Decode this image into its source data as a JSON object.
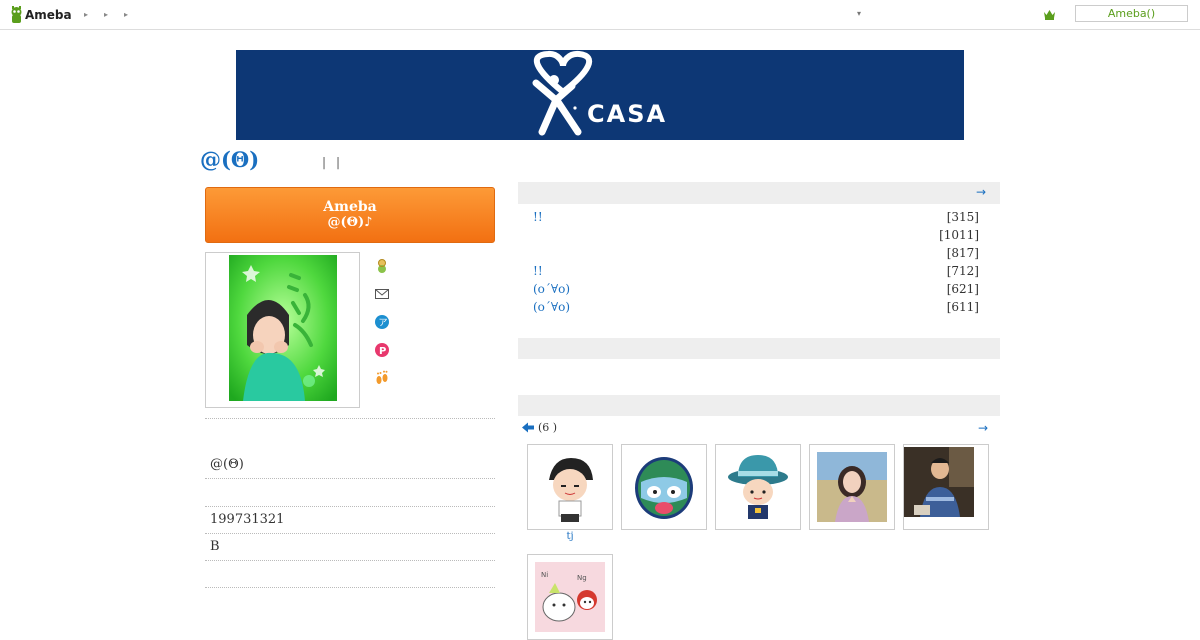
{
  "topbar": {
    "logo_text": "Ameba",
    "nav_arrows": [
      "▸",
      "▸",
      "▸"
    ],
    "dropdown_glyph": "▾",
    "login_label": "Ameba()"
  },
  "banner": {
    "brand": "CASA",
    "mark": "®"
  },
  "blog": {
    "title": "@(Θ)",
    "separators": [
      "|",
      "|"
    ]
  },
  "cta": {
    "line1": "Ameba",
    "line2": "@(Θ)♪"
  },
  "side_icons": [
    "friend-icon",
    "mail-icon",
    "app-icon",
    "pigg-icon",
    "footprint-icon"
  ],
  "profile": {
    "rows": [
      "",
      "@(Θ)",
      "",
      "199731321",
      "B",
      ""
    ]
  },
  "rankings": {
    "more": "→",
    "items": [
      {
        "title": "!!",
        "count": "[315]"
      },
      {
        "title": "",
        "count": "[1011]"
      },
      {
        "title": "",
        "count": "[817]"
      },
      {
        "title": "!!",
        "count": "[712]"
      },
      {
        "title": "(o´∀o)",
        "count": "[621]"
      },
      {
        "title": "(o´∀o)",
        "count": "[611]"
      }
    ]
  },
  "friends": {
    "back": "🡄",
    "count_label": "(6 )",
    "more": "→",
    "items": [
      {
        "name": "tj"
      },
      {
        "name": ""
      },
      {
        "name": ""
      },
      {
        "name": ""
      },
      {
        "name": ""
      },
      {
        "name": ""
      }
    ]
  },
  "colors": {
    "accent": "#1a6fc0",
    "cta": "#f27012",
    "banner": "#0d3775",
    "ameba_green": "#5a9e1c"
  }
}
